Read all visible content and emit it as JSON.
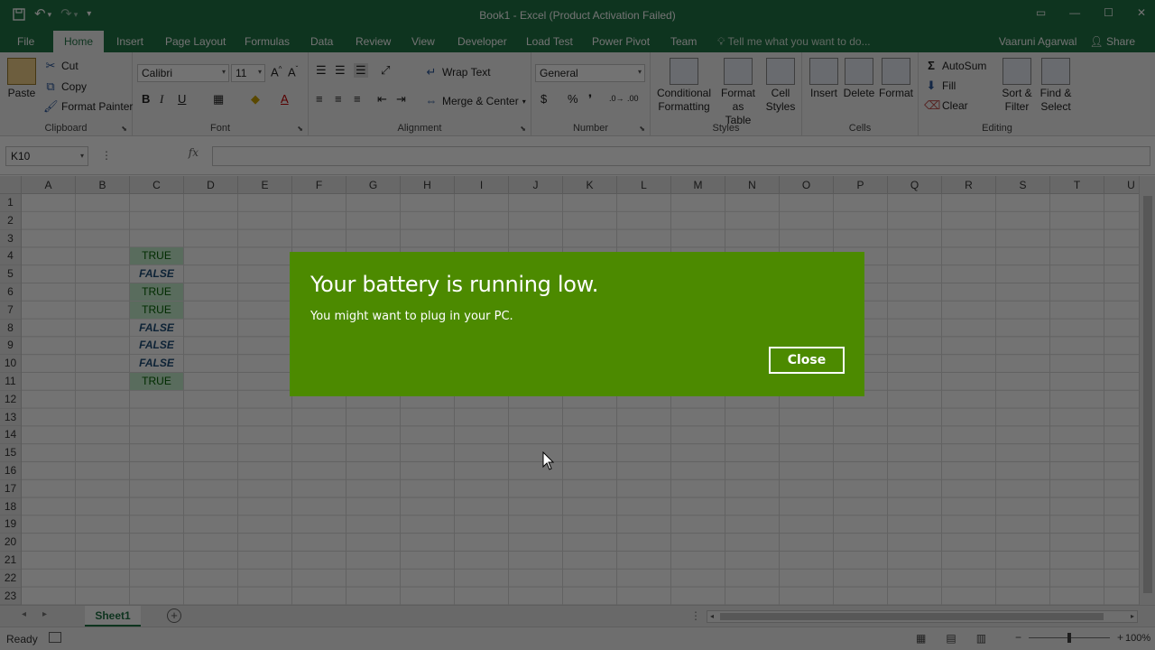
{
  "window": {
    "title": "Book1 - Excel (Product Activation Failed)",
    "controls": [
      "▭",
      "—",
      "☐",
      "✕"
    ]
  },
  "quick_access": {
    "save_icon": "save-icon",
    "undo_icon": "undo-icon",
    "redo_icon": "redo-icon",
    "customize_icon": "customize-qat-icon"
  },
  "tabs": [
    "File",
    "Home",
    "Insert",
    "Page Layout",
    "Formulas",
    "Data",
    "Review",
    "View",
    "Developer",
    "Load Test",
    "Power Pivot",
    "Team"
  ],
  "active_tab": "Home",
  "tell_me": "Tell me what you want to do...",
  "user": {
    "name": "Vaaruni Agarwal",
    "share": "Share"
  },
  "ribbon": {
    "clipboard": {
      "paste": "Paste",
      "cut": "Cut",
      "copy": "Copy",
      "format_painter": "Format Painter",
      "label": "Clipboard"
    },
    "font": {
      "name": "Calibri",
      "size": "11",
      "bold": "B",
      "italic": "I",
      "underline": "U",
      "label": "Font"
    },
    "alignment": {
      "wrap_text": "Wrap Text",
      "merge_center": "Merge & Center",
      "label": "Alignment"
    },
    "number": {
      "format": "General",
      "currency": "$",
      "percent": "%",
      "comma": "❜",
      "label": "Number"
    },
    "styles": {
      "conditional": [
        "Conditional",
        "Formatting"
      ],
      "format_table": [
        "Format as",
        "Table"
      ],
      "cell_styles": [
        "Cell",
        "Styles"
      ],
      "label": "Styles"
    },
    "cells": {
      "insert": "Insert",
      "delete": "Delete",
      "format": "Format",
      "label": "Cells"
    },
    "editing": {
      "autosum": "AutoSum",
      "fill": "Fill",
      "clear": "Clear",
      "sort_filter": [
        "Sort &",
        "Filter"
      ],
      "find_select": [
        "Find &",
        "Select"
      ],
      "label": "Editing"
    }
  },
  "formula_bar": {
    "name_box": "K10",
    "fx": "fx",
    "value": ""
  },
  "columns": [
    "A",
    "B",
    "C",
    "D",
    "E",
    "F",
    "G",
    "H",
    "I",
    "J",
    "K",
    "L",
    "M",
    "N",
    "O",
    "P",
    "Q",
    "R",
    "S",
    "T",
    "U"
  ],
  "rows": [
    "1",
    "2",
    "3",
    "4",
    "5",
    "6",
    "7",
    "8",
    "9",
    "10",
    "11",
    "12",
    "13",
    "14",
    "15",
    "16",
    "17",
    "18",
    "19",
    "20",
    "21",
    "22",
    "23"
  ],
  "cells_c": [
    {
      "row": 4,
      "value": "TRUE"
    },
    {
      "row": 5,
      "value": "FALSE"
    },
    {
      "row": 6,
      "value": "TRUE"
    },
    {
      "row": 7,
      "value": "TRUE"
    },
    {
      "row": 8,
      "value": "FALSE"
    },
    {
      "row": 9,
      "value": "FALSE"
    },
    {
      "row": 10,
      "value": "FALSE"
    },
    {
      "row": 11,
      "value": "TRUE"
    }
  ],
  "sheets": [
    "Sheet1"
  ],
  "status": {
    "ready": "Ready",
    "zoom": "100%",
    "zoom_level": 1.0
  },
  "notification": {
    "title": "Your battery is running low.",
    "message": "You might want to plug in your PC.",
    "close_label": "Close",
    "color": "#4c8a00"
  }
}
